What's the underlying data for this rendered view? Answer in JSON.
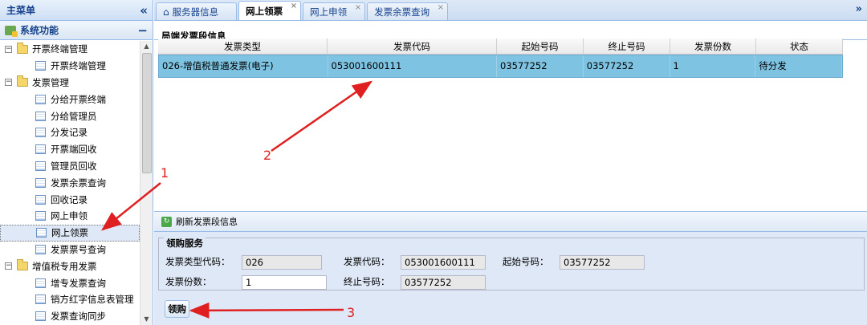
{
  "sidebar": {
    "title": "主菜单",
    "collapse_icon": "double-chevron-left-icon",
    "section": "系统功能",
    "items": [
      {
        "type": "folder",
        "label": "开票终端管理",
        "toggle": "−"
      },
      {
        "type": "leaf",
        "label": "开票终端管理"
      },
      {
        "type": "folder",
        "label": "发票管理",
        "toggle": "−"
      },
      {
        "type": "leaf",
        "label": "分给开票终端"
      },
      {
        "type": "leaf",
        "label": "分给管理员"
      },
      {
        "type": "leaf",
        "label": "分发记录"
      },
      {
        "type": "leaf",
        "label": "开票端回收"
      },
      {
        "type": "leaf",
        "label": "管理员回收"
      },
      {
        "type": "leaf",
        "label": "发票余票查询"
      },
      {
        "type": "leaf",
        "label": "回收记录"
      },
      {
        "type": "leaf",
        "label": "网上申领"
      },
      {
        "type": "leaf",
        "label": "网上领票",
        "selected": true
      },
      {
        "type": "leaf",
        "label": "发票票号查询"
      },
      {
        "type": "folder",
        "label": "增值税专用发票",
        "toggle": "−"
      },
      {
        "type": "leaf",
        "label": "增专发票查询"
      },
      {
        "type": "leaf",
        "label": "销方红字信息表管理"
      },
      {
        "type": "leaf",
        "label": "发票查询同步"
      }
    ]
  },
  "tabs": [
    {
      "label": "服务器信息",
      "icon": "home-icon",
      "closable": false
    },
    {
      "label": "网上领票",
      "active": true,
      "closable": true
    },
    {
      "label": "网上申领",
      "closable": true
    },
    {
      "label": "发票余票查询",
      "closable": true
    }
  ],
  "grid": {
    "title": "局端发票段信息",
    "columns": [
      "发票类型",
      "发票代码",
      "起始号码",
      "终止号码",
      "发票份数",
      "状态"
    ],
    "rows": [
      [
        "026-增值税普通发票(电子)",
        "053001600111",
        "03577252",
        "03577252",
        "1",
        "待分发"
      ]
    ]
  },
  "toolbar": {
    "refresh_label": "刷新发票段信息"
  },
  "form": {
    "legend": "领购服务",
    "type_code_label": "发票类型代码：",
    "type_code_value": "026",
    "invoice_code_label": "发票代码：",
    "invoice_code_value": "053001600111",
    "start_no_label": "起始号码：",
    "start_no_value": "03577252",
    "count_label": "发票份数：",
    "count_value": "1",
    "end_no_label": "终止号码：",
    "end_no_value": "03577252",
    "buy_button": "领购"
  },
  "annotations": [
    "1",
    "2",
    "3"
  ],
  "colors": {
    "annotation": "#e02020",
    "selected_row": "#7ec3e1",
    "accent": "#15428b"
  }
}
